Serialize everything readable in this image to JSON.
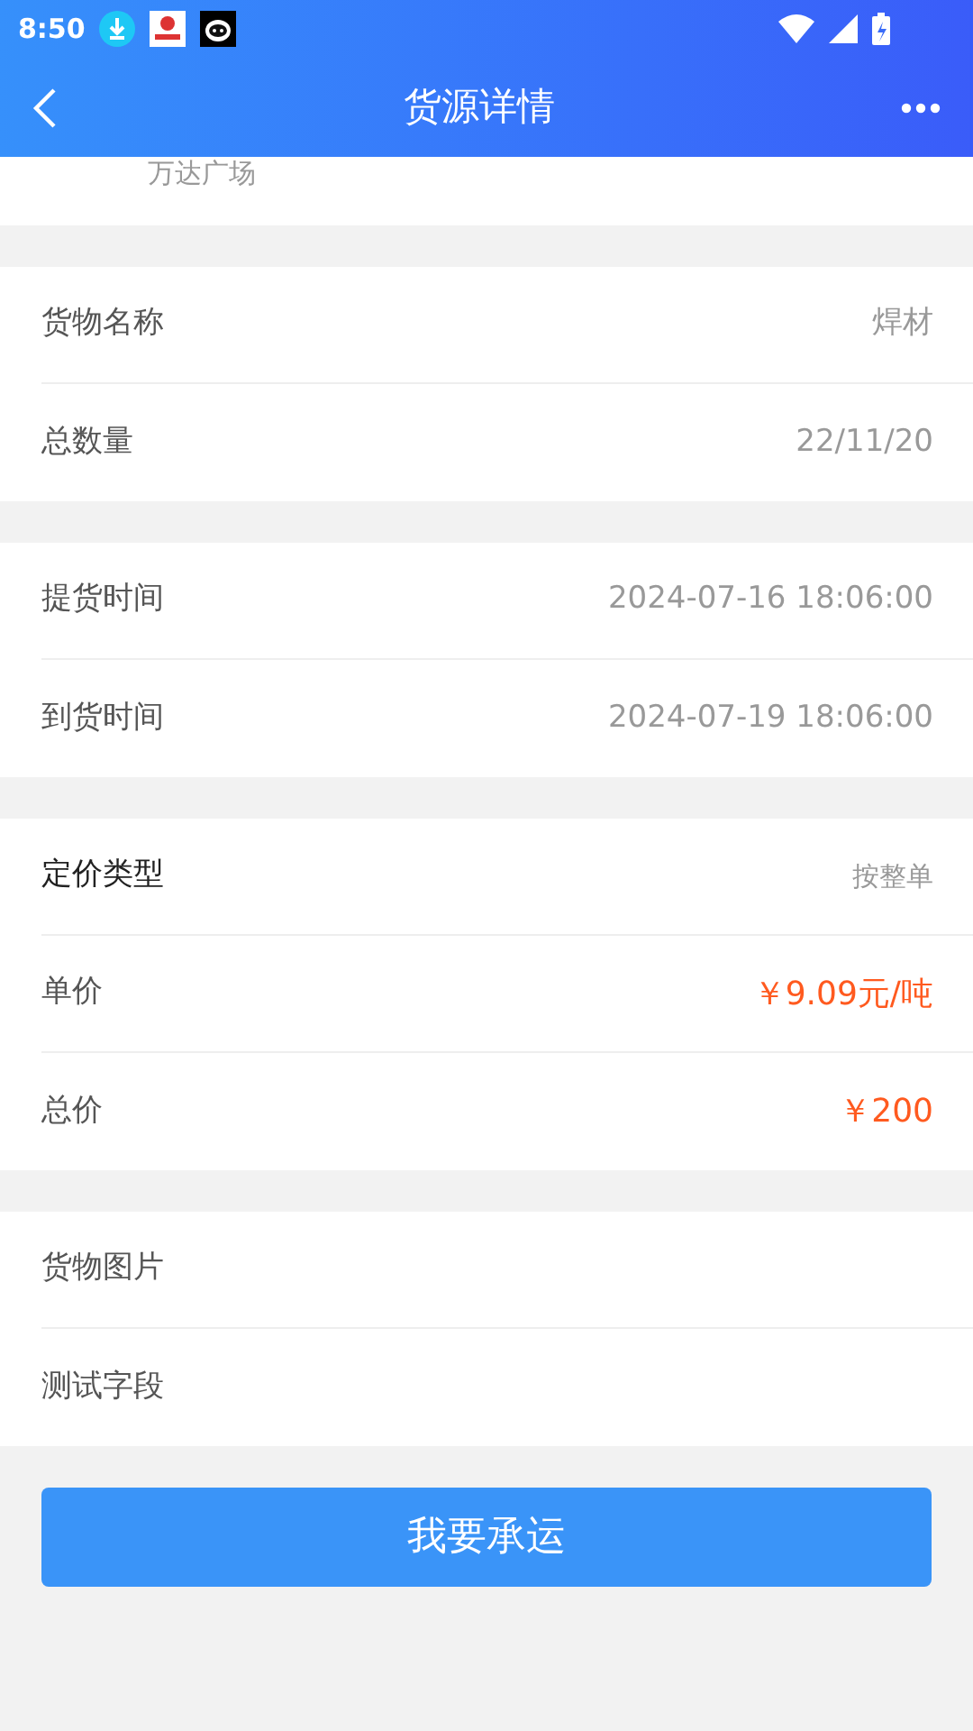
{
  "status_bar": {
    "time": "8:50"
  },
  "header": {
    "title": "货源详情"
  },
  "address": {
    "text": "万达广场"
  },
  "sections": [
    {
      "rows": [
        {
          "kind": "normal",
          "label": "货物名称",
          "value": "焊材"
        },
        {
          "kind": "normal",
          "label": "总数量",
          "value": "22/11/20"
        }
      ]
    },
    {
      "rows": [
        {
          "kind": "normal",
          "label": "提货时间",
          "value": "2024-07-16 18:06:00"
        },
        {
          "kind": "normal",
          "label": "到货时间",
          "value": "2024-07-19 18:06:00"
        }
      ]
    },
    {
      "rows": [
        {
          "kind": "small",
          "label": "定价类型",
          "value": "按整单"
        },
        {
          "kind": "price",
          "label": "单价",
          "value": "￥9.09元/吨"
        },
        {
          "kind": "price",
          "label": "总价",
          "value": "￥200"
        }
      ]
    },
    {
      "rows": [
        {
          "kind": "blank",
          "label": "货物图片"
        },
        {
          "kind": "blank",
          "label": "测试字段"
        }
      ]
    }
  ],
  "action_button": "我要承运"
}
